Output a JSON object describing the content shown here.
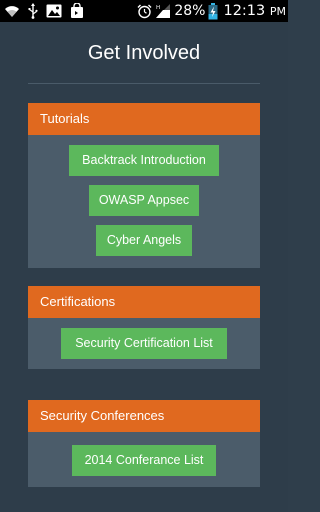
{
  "status_bar": {
    "battery_percent": "28%",
    "time": "12:13",
    "time_suffix": "PM",
    "icons": [
      "wifi-icon",
      "usb-icon",
      "image-icon",
      "shopping-bag-icon",
      "alarm-icon",
      "signal-icon",
      "battery-charging-icon"
    ]
  },
  "page": {
    "title": "Get Involved"
  },
  "sections": [
    {
      "header": "Tutorials",
      "buttons": [
        "Backtrack Introduction",
        "OWASP Appsec",
        "Cyber Angels"
      ]
    },
    {
      "header": "Certifications",
      "buttons": [
        "Security Certification List"
      ]
    },
    {
      "header": "Security Conferences",
      "buttons": [
        "2014 Conferance List"
      ]
    }
  ],
  "colors": {
    "background": "#2e3d4a",
    "section_header": "#e0691f",
    "section_body": "#4b5c6a",
    "button": "#5cb85c",
    "text": "#ffffff",
    "battery_accent": "#33b5e5"
  }
}
